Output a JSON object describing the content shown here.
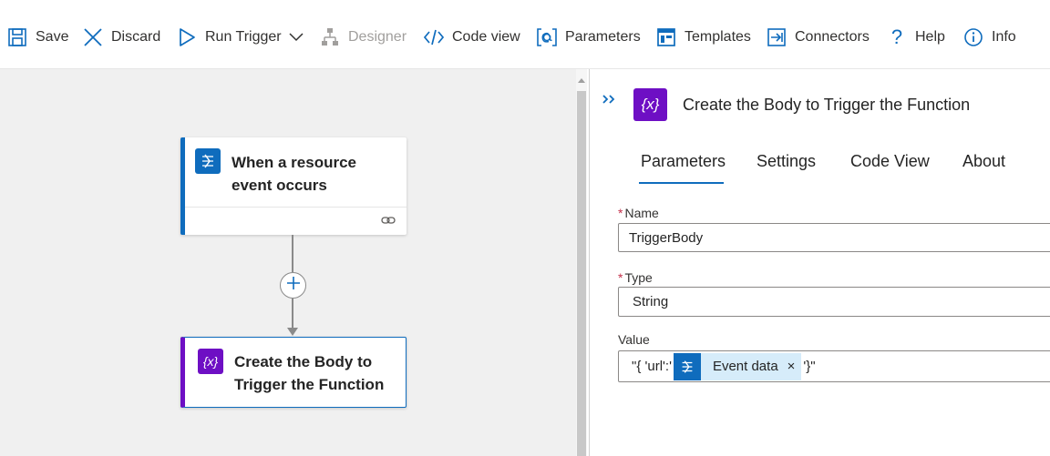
{
  "toolbar": {
    "save": "Save",
    "discard": "Discard",
    "run_trigger": "Run Trigger",
    "designer": "Designer",
    "code_view": "Code view",
    "parameters": "Parameters",
    "templates": "Templates",
    "connectors": "Connectors",
    "help": "Help",
    "info": "Info"
  },
  "canvas": {
    "trigger_card": {
      "title_line1": "When a resource",
      "title_line2": "event occurs"
    },
    "action_card": {
      "title_line1": "Create the Body to",
      "title_line2": "Trigger the Function"
    },
    "action_icon_glyph": "{x}"
  },
  "panel": {
    "title": "Create the Body to Trigger the Function",
    "icon_glyph": "{x}",
    "tabs": [
      "Parameters",
      "Settings",
      "Code View",
      "About"
    ],
    "active_tab": "Parameters",
    "fields": {
      "name": {
        "label": "Name",
        "required_marker": "*",
        "value": "TriggerBody"
      },
      "type": {
        "label": "Type",
        "required_marker": "*",
        "value": "String"
      },
      "value": {
        "label": "Value",
        "prefix": "\"{ 'url':'",
        "token_label": "Event data",
        "token_close": "×",
        "suffix": "'}\""
      }
    }
  },
  "colors": {
    "accent_blue": "#0f6cbd",
    "variable_purple": "#6e0fc4",
    "canvas_bg": "#f0f0f0",
    "required_red": "#c4314b"
  }
}
